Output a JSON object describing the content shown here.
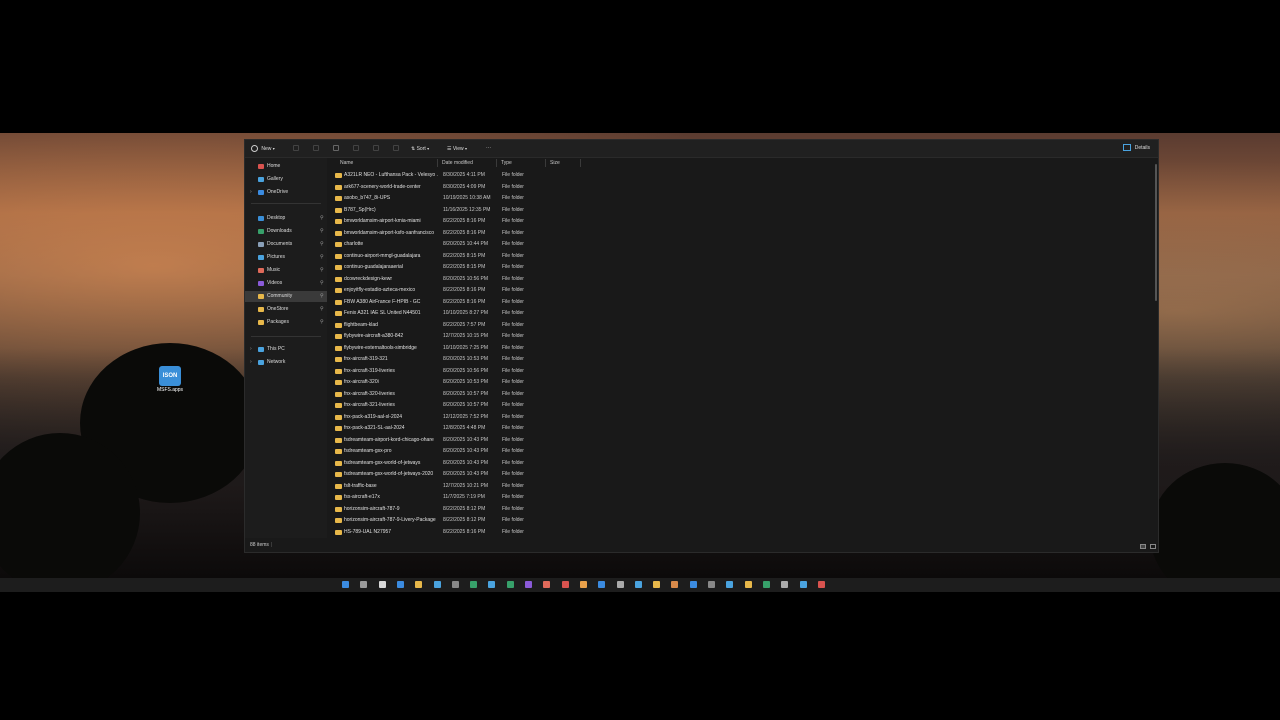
{
  "desktop": {
    "icon_label": "MSFS.apps",
    "icon_text": "ISON"
  },
  "toolbar": {
    "new_label": "New",
    "sort_label": "Sort",
    "view_label": "View",
    "more_label": "···",
    "details_label": "Details"
  },
  "nav": [
    {
      "label": "Home",
      "color": "#d9534f",
      "pinned": false,
      "chev": false
    },
    {
      "label": "Gallery",
      "color": "#4aa3df",
      "pinned": false,
      "chev": false
    },
    {
      "label": "OneDrive",
      "color": "#3b8be0",
      "pinned": false,
      "chev": true
    },
    {
      "label": "Desktop",
      "color": "#3a8fd8",
      "pinned": true,
      "chev": false
    },
    {
      "label": "Downloads",
      "color": "#37a06a",
      "pinned": true,
      "chev": false
    },
    {
      "label": "Documents",
      "color": "#8aa0b8",
      "pinned": true,
      "chev": false
    },
    {
      "label": "Pictures",
      "color": "#4aa3df",
      "pinned": true,
      "chev": false
    },
    {
      "label": "Music",
      "color": "#e06a5a",
      "pinned": true,
      "chev": false
    },
    {
      "label": "Videos",
      "color": "#8a5ad8",
      "pinned": true,
      "chev": false
    },
    {
      "label": "Community",
      "color": "#e8b84a",
      "pinned": true,
      "chev": false,
      "active": true
    },
    {
      "label": "OneStore",
      "color": "#e8b84a",
      "pinned": true,
      "chev": false
    },
    {
      "label": "Packages",
      "color": "#e8b84a",
      "pinned": true,
      "chev": false
    },
    {
      "label": "This PC",
      "color": "#4aa3df",
      "pinned": false,
      "chev": true
    },
    {
      "label": "Network",
      "color": "#4aa3df",
      "pinned": false,
      "chev": true
    }
  ],
  "columns": {
    "name": "Name",
    "date": "Date modified",
    "type": "Type",
    "size": "Size"
  },
  "files": [
    {
      "name": "A321LR NEO - Lufthansa Pack - Velesyo ...",
      "date": "8/30/2025 4:11 PM",
      "type": "File folder"
    },
    {
      "name": "ark677-scenery-world-trade-center",
      "date": "8/30/2025 4:09 PM",
      "type": "File folder"
    },
    {
      "name": "asobo_b747_8i-UPS",
      "date": "10/19/2025 10:38 AM",
      "type": "File folder"
    },
    {
      "name": "B787_Sp(Hrc)",
      "date": "11/16/2025 12:35 PM",
      "type": "File folder"
    },
    {
      "name": "bmworldamsim-airport-kmia-miami",
      "date": "8/22/2025 8:16 PM",
      "type": "File folder"
    },
    {
      "name": "bmworldamsim-airport-ksfo-sanfrancisco",
      "date": "8/22/2025 8:16 PM",
      "type": "File folder"
    },
    {
      "name": "charlotte",
      "date": "8/20/2025 10:44 PM",
      "type": "File folder"
    },
    {
      "name": "continuo-airport-mmgl-guadalajara",
      "date": "8/22/2025 8:15 PM",
      "type": "File folder"
    },
    {
      "name": "continuo-guadalajaraaerial",
      "date": "8/22/2025 8:15 PM",
      "type": "File folder"
    },
    {
      "name": "dcowreckdesign-kewr",
      "date": "8/20/2025 10:56 PM",
      "type": "File folder"
    },
    {
      "name": "enjoyitfly-estadio-azteca-mexico",
      "date": "8/22/2025 8:16 PM",
      "type": "File folder"
    },
    {
      "name": "FBW A380 AirFrance F-HPIB - GC",
      "date": "8/22/2025 8:16 PM",
      "type": "File folder"
    },
    {
      "name": "Fenix A321 IAE SL United N44501",
      "date": "10/10/2025 8:27 PM",
      "type": "File folder"
    },
    {
      "name": "flightbeam-klad",
      "date": "8/22/2025 7:57 PM",
      "type": "File folder"
    },
    {
      "name": "flybywire-aircraft-a380-842",
      "date": "12/7/2025 10:15 PM",
      "type": "File folder"
    },
    {
      "name": "flybywire-externaltools-simbridge",
      "date": "10/10/2025 7:25 PM",
      "type": "File folder"
    },
    {
      "name": "fnx-aircraft-319-321",
      "date": "8/20/2025 10:53 PM",
      "type": "File folder"
    },
    {
      "name": "fnx-aircraft-319-liveries",
      "date": "8/20/2025 10:56 PM",
      "type": "File folder"
    },
    {
      "name": "fnx-aircraft-320i",
      "date": "8/20/2025 10:53 PM",
      "type": "File folder"
    },
    {
      "name": "fnx-aircraft-320-liveries",
      "date": "8/20/2025 10:57 PM",
      "type": "File folder"
    },
    {
      "name": "fnx-aircraft-321-liveries",
      "date": "8/20/2025 10:57 PM",
      "type": "File folder"
    },
    {
      "name": "fnx-pack-a319-aal-sl-2024",
      "date": "12/12/2025 7:52 PM",
      "type": "File folder"
    },
    {
      "name": "fnx-pack-a321-SL-aal-2024",
      "date": "12/8/2025 4:48 PM",
      "type": "File folder"
    },
    {
      "name": "fsdreamteam-airport-kord-chicago-ohare",
      "date": "8/20/2025 10:43 PM",
      "type": "File folder"
    },
    {
      "name": "fsdreamteam-gsx-pro",
      "date": "8/20/2025 10:43 PM",
      "type": "File folder"
    },
    {
      "name": "fsdreamteam-gsx-world-of-jetways",
      "date": "8/20/2025 10:43 PM",
      "type": "File folder"
    },
    {
      "name": "fsdreamteam-gsx-world-of-jetways-2020",
      "date": "8/20/2025 10:43 PM",
      "type": "File folder"
    },
    {
      "name": "fslt-traffic-base",
      "date": "12/7/2025 10:21 PM",
      "type": "File folder"
    },
    {
      "name": "fss-aircraft-e17x",
      "date": "11/7/2025 7:19 PM",
      "type": "File folder"
    },
    {
      "name": "horizonsim-aircraft-787-9",
      "date": "8/22/2025 8:12 PM",
      "type": "File folder"
    },
    {
      "name": "horizonsim-aircraft-787-9-Livery-Package",
      "date": "8/22/2025 8:12 PM",
      "type": "File folder"
    },
    {
      "name": "HS-789-UAL N27957",
      "date": "8/22/2025 8:16 PM",
      "type": "File folder"
    }
  ],
  "status": {
    "items_count": "88 items",
    "sep": "|"
  }
}
